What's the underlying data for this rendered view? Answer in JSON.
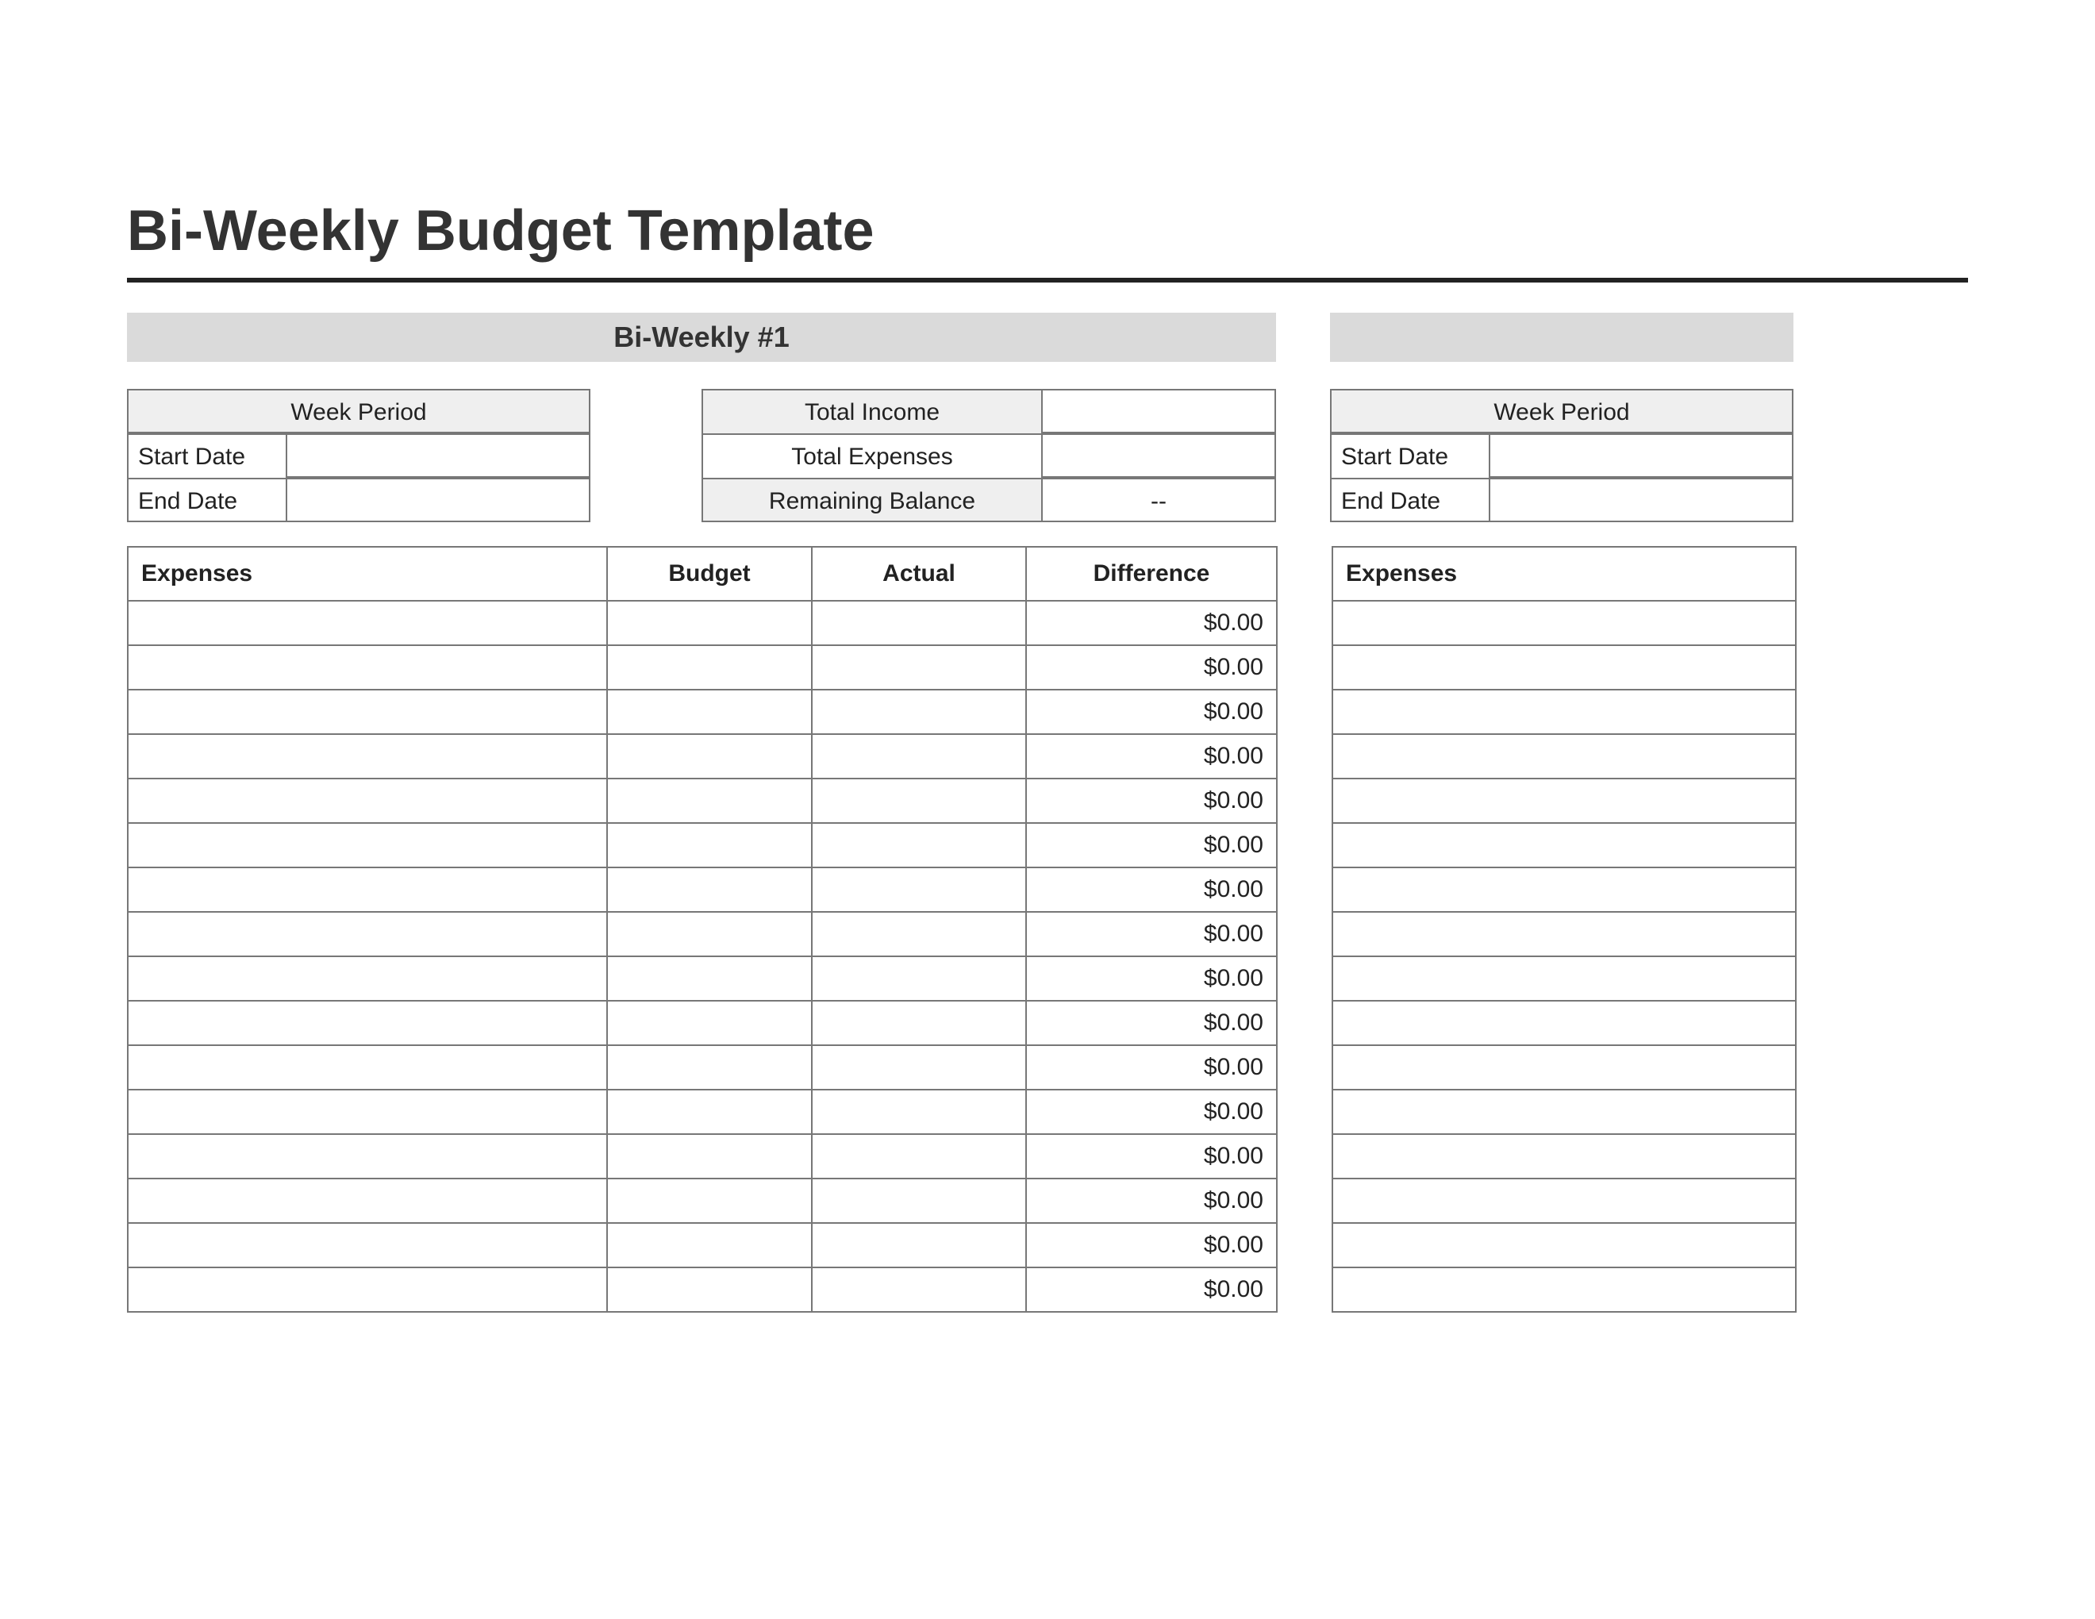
{
  "title": "Bi-Weekly Budget Template",
  "left_section_header": "Bi-Weekly #1",
  "week_period_label": "Week Period",
  "start_date_label": "Start Date",
  "end_date_label": "End Date",
  "total_income_label": "Total Income",
  "total_expenses_label": "Total Expenses",
  "remaining_balance_label": "Remaining Balance",
  "remaining_balance_value": "--",
  "columns": {
    "expenses": "Expenses",
    "budget": "Budget",
    "actual": "Actual",
    "difference": "Difference"
  },
  "rows": [
    {
      "difference": "$0.00"
    },
    {
      "difference": "$0.00"
    },
    {
      "difference": "$0.00"
    },
    {
      "difference": "$0.00"
    },
    {
      "difference": "$0.00"
    },
    {
      "difference": "$0.00"
    },
    {
      "difference": "$0.00"
    },
    {
      "difference": "$0.00"
    },
    {
      "difference": "$0.00"
    },
    {
      "difference": "$0.00"
    },
    {
      "difference": "$0.00"
    },
    {
      "difference": "$0.00"
    },
    {
      "difference": "$0.00"
    },
    {
      "difference": "$0.00"
    },
    {
      "difference": "$0.00"
    },
    {
      "difference": "$0.00"
    }
  ],
  "right": {
    "week_period_label": "Week Period",
    "start_date_label": "Start Date",
    "end_date_label": "End Date",
    "expenses_label": "Expenses"
  }
}
